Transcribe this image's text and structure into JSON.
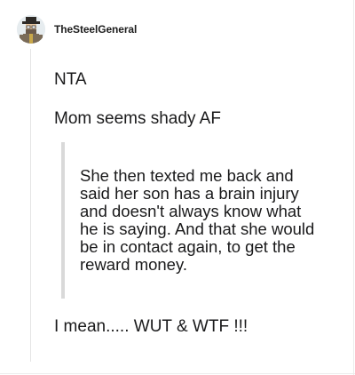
{
  "post": {
    "username": "TheSteelGeneral",
    "avatar_icon": "avatar-figure-icon",
    "paragraphs": {
      "first": "NTA",
      "second": "Mom seems shady AF",
      "quote": "She then texted me back and said her son has a brain injury and doesn't always know what he is saying. And that she would be in contact again, to get the reward money.",
      "last": "I mean..... WUT & WTF !!!"
    }
  },
  "colors": {
    "text": "#1a1a1b",
    "quote_bar": "#d9d9d9",
    "thread_line": "#e4e4e4"
  }
}
